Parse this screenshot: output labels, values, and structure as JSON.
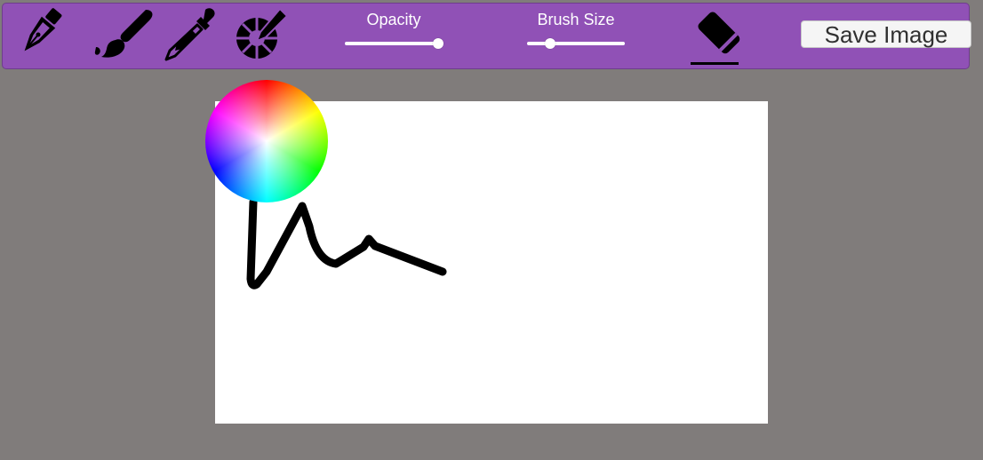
{
  "toolbar": {
    "background": "#9051b6",
    "tools": [
      {
        "name": "pen-tool",
        "icon": "fountain-pen-icon"
      },
      {
        "name": "brush-tool",
        "icon": "paint-brush-icon"
      },
      {
        "name": "eyedropper-tool",
        "icon": "eyedropper-icon"
      },
      {
        "name": "color-picker-tool",
        "icon": "color-wheel-pencil-icon"
      },
      {
        "name": "eraser-tool",
        "icon": "eraser-icon"
      }
    ],
    "opacity": {
      "label": "Opacity",
      "value": 0.95
    },
    "brush_size": {
      "label": "Brush Size",
      "value": 0.24
    },
    "save_label": "Save Image"
  },
  "canvas": {
    "background": "#ffffff",
    "stroke_color": "#000000"
  },
  "color_wheel": {
    "visible": true
  }
}
